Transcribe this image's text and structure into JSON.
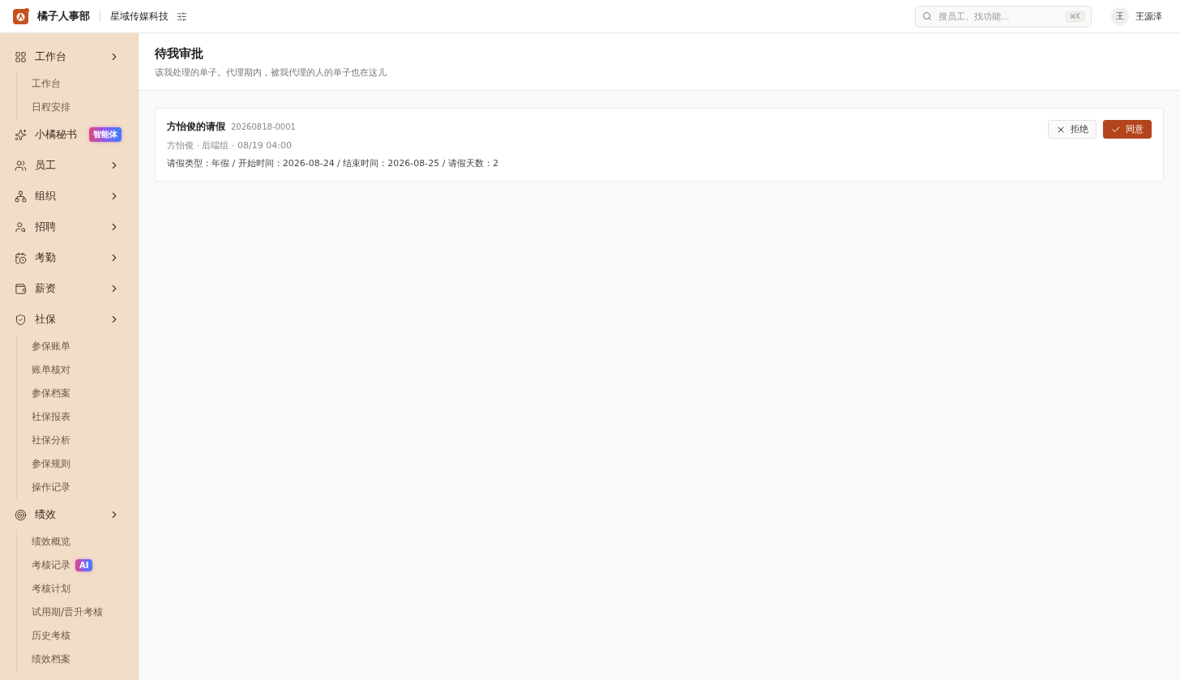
{
  "topbar": {
    "app_name": "橘子人事部",
    "company": "星域传媒科技",
    "search": {
      "placeholder": "搜员工、找功能...",
      "shortcut": "⌘K"
    },
    "user": {
      "avatar": "王",
      "name": "王源泽"
    }
  },
  "sidebar": {
    "items": [
      {
        "label": "工作台",
        "chevron": true,
        "children": [
          {
            "label": "工作台"
          },
          {
            "label": "日程安排"
          }
        ]
      },
      {
        "label": "小橘秘书",
        "chevron": false,
        "badge": "智能体"
      },
      {
        "label": "员工",
        "chevron": true
      },
      {
        "label": "组织",
        "chevron": true
      },
      {
        "label": "招聘",
        "chevron": true
      },
      {
        "label": "考勤",
        "chevron": true
      },
      {
        "label": "薪资",
        "chevron": true
      },
      {
        "label": "社保",
        "chevron": true,
        "children": [
          {
            "label": "参保账单"
          },
          {
            "label": "账单核对"
          },
          {
            "label": "参保档案"
          },
          {
            "label": "社保报表"
          },
          {
            "label": "社保分析"
          },
          {
            "label": "参保规则"
          },
          {
            "label": "操作记录"
          }
        ]
      },
      {
        "label": "绩效",
        "chevron": true,
        "children": [
          {
            "label": "绩效概览"
          },
          {
            "label": "考核记录",
            "badge": "AI"
          },
          {
            "label": "考核计划"
          },
          {
            "label": "试用期/晋升考核"
          },
          {
            "label": "历史考核"
          },
          {
            "label": "绩效档案"
          }
        ]
      }
    ]
  },
  "page": {
    "title": "待我审批",
    "subtitle": "该我处理的单子。代理期内，被我代理的人的单子也在这儿"
  },
  "requests": [
    {
      "title": "方怡俊的请假",
      "number": "20260818-0001",
      "meta": "方怡俊 · 后端组 · 08/19 04:00",
      "details": "请假类型：年假 / 开始时间：2026-08-24 / 结束时间：2026-08-25 / 请假天数：2",
      "actions": [
        {
          "label": "拒绝",
          "kind": "reject"
        },
        {
          "label": "同意",
          "kind": "approve"
        }
      ]
    }
  ]
}
